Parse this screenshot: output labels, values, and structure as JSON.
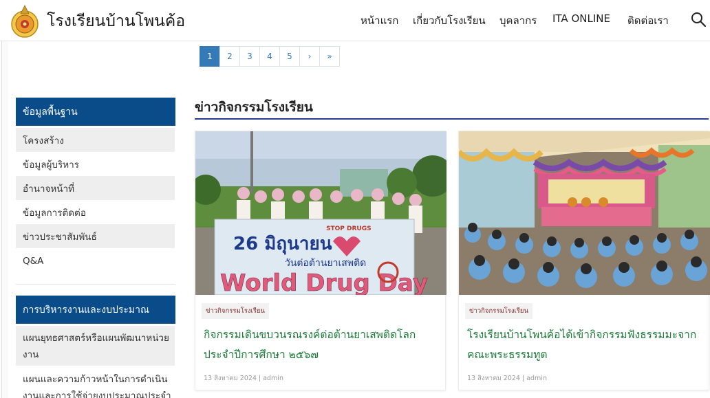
{
  "header": {
    "site_title": "โรงเรียนบ้านโพนค้อ",
    "nav": [
      "หน้าแรก",
      "เกี่ยวกับโรงเรียน",
      "บุคลากร",
      "ITA ONLINE",
      "ติดต่อเรา"
    ]
  },
  "pagination": [
    "1",
    "2",
    "3",
    "4",
    "5",
    "›",
    "»"
  ],
  "sidebar": {
    "section1": {
      "title": "ข้อมูลพื้นฐาน",
      "items": [
        "โครงสร้าง",
        "ข้อมูลผู้บริหาร",
        "อำนาจหน้าที่",
        "ข้อมูลการติดต่อ",
        "ข่าวประชาสัมพันธ์",
        "Q&A"
      ]
    },
    "section2": {
      "title": "การบริหารงานและงบประมาณ",
      "items": [
        "แผนยุทธศาสตร์หรือแผนพัฒนาหน่วยงาน",
        "แผนและความก้าวหน้าในการดำเนินงานและการใช้จ่ายงบประมาณประจำ"
      ]
    }
  },
  "main": {
    "section_title": "ข่าวกิจกรรมโรงเรียน",
    "cards": [
      {
        "category": "ข่าวกิจกรรมโรงเรียน",
        "title": "กิจกรรมเดินขบวนรณรงค์ต่อต้านยาเสพติดโลก ประจำปีการศึกษา ๒๕๖๗",
        "meta": "13 สิงหาคม 2024 | admin",
        "banner": {
          "line1": "26 มิถุนายน",
          "line2": "วันต่อต้านยาเสพติด",
          "line3": "World Drug Day",
          "stamp": "STOP DRUGS"
        }
      },
      {
        "category": "ข่าวกิจกรรมโรงเรียน",
        "title": "โรงเรียนบ้านโพนค้อได้เข้ากิจกรรมฟังธรรมมะจาก คณะพระธรรมทูต",
        "meta": "13 สิงหาคม 2024 | admin"
      }
    ]
  },
  "colors": {
    "accent": "#0a4c8a",
    "link_green": "#1e7b3b",
    "rule": "#2b3a8f",
    "page_active": "#337ab7"
  }
}
